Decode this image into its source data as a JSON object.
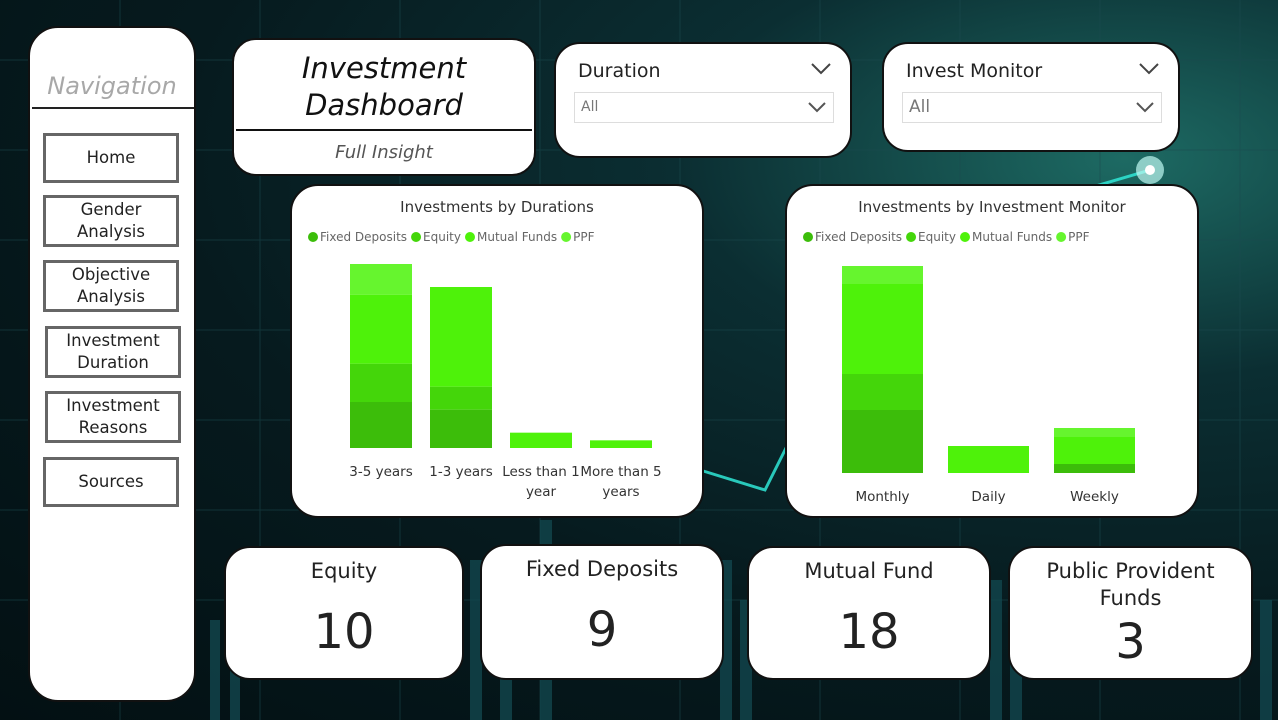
{
  "navigation": {
    "title": "Navigation",
    "items": [
      {
        "label": "Home"
      },
      {
        "label": "Gender\nAnalysis"
      },
      {
        "label": "Objective\nAnalysis"
      },
      {
        "label": "Investment\nDuration"
      },
      {
        "label": "Investment\nReasons"
      },
      {
        "label": "Sources"
      }
    ]
  },
  "header": {
    "title": "Investment\nDashboard",
    "subtitle": "Full Insight"
  },
  "slicers": {
    "duration": {
      "label": "Duration",
      "value": "All"
    },
    "monitor": {
      "label": "Invest Monitor",
      "value": "All"
    }
  },
  "colors": {
    "fixed_deposits": "#3cbd0a",
    "equity": "#44d60a",
    "mutual_funds": "#4ef20a",
    "ppf": "#66f52e"
  },
  "chart_data": [
    {
      "type": "bar",
      "stacked": true,
      "title": "Investments by Durations",
      "legend_position": "top-left",
      "categories": [
        "3-5 years",
        "1-3 years",
        "Less than 1 year",
        "More than 5 years"
      ],
      "series": [
        {
          "name": "Fixed Deposits",
          "values": [
            6,
            5,
            0,
            0
          ]
        },
        {
          "name": "Equity",
          "values": [
            5,
            3,
            0,
            0
          ]
        },
        {
          "name": "Mutual Funds",
          "values": [
            9,
            13,
            2,
            1
          ]
        },
        {
          "name": "PPF",
          "values": [
            4,
            0,
            0,
            0
          ]
        }
      ],
      "ylim": [
        0,
        24
      ],
      "grid": false
    },
    {
      "type": "bar",
      "stacked": true,
      "title": "Investments by Investment Monitor",
      "legend_position": "top-left",
      "categories": [
        "Monthly",
        "Daily",
        "Weekly"
      ],
      "series": [
        {
          "name": "Fixed Deposits",
          "values": [
            7,
            0,
            1
          ]
        },
        {
          "name": "Equity",
          "values": [
            4,
            0,
            0
          ]
        },
        {
          "name": "Mutual Funds",
          "values": [
            10,
            3,
            3
          ]
        },
        {
          "name": "PPF",
          "values": [
            2,
            0,
            1
          ]
        }
      ],
      "ylim": [
        0,
        23
      ],
      "grid": false
    }
  ],
  "kpis": [
    {
      "label": "Equity",
      "value": "10"
    },
    {
      "label": "Fixed Deposits",
      "value": "9"
    },
    {
      "label": "Mutual Fund",
      "value": "18"
    },
    {
      "label": "Public Provident\nFunds",
      "value": "3"
    }
  ]
}
